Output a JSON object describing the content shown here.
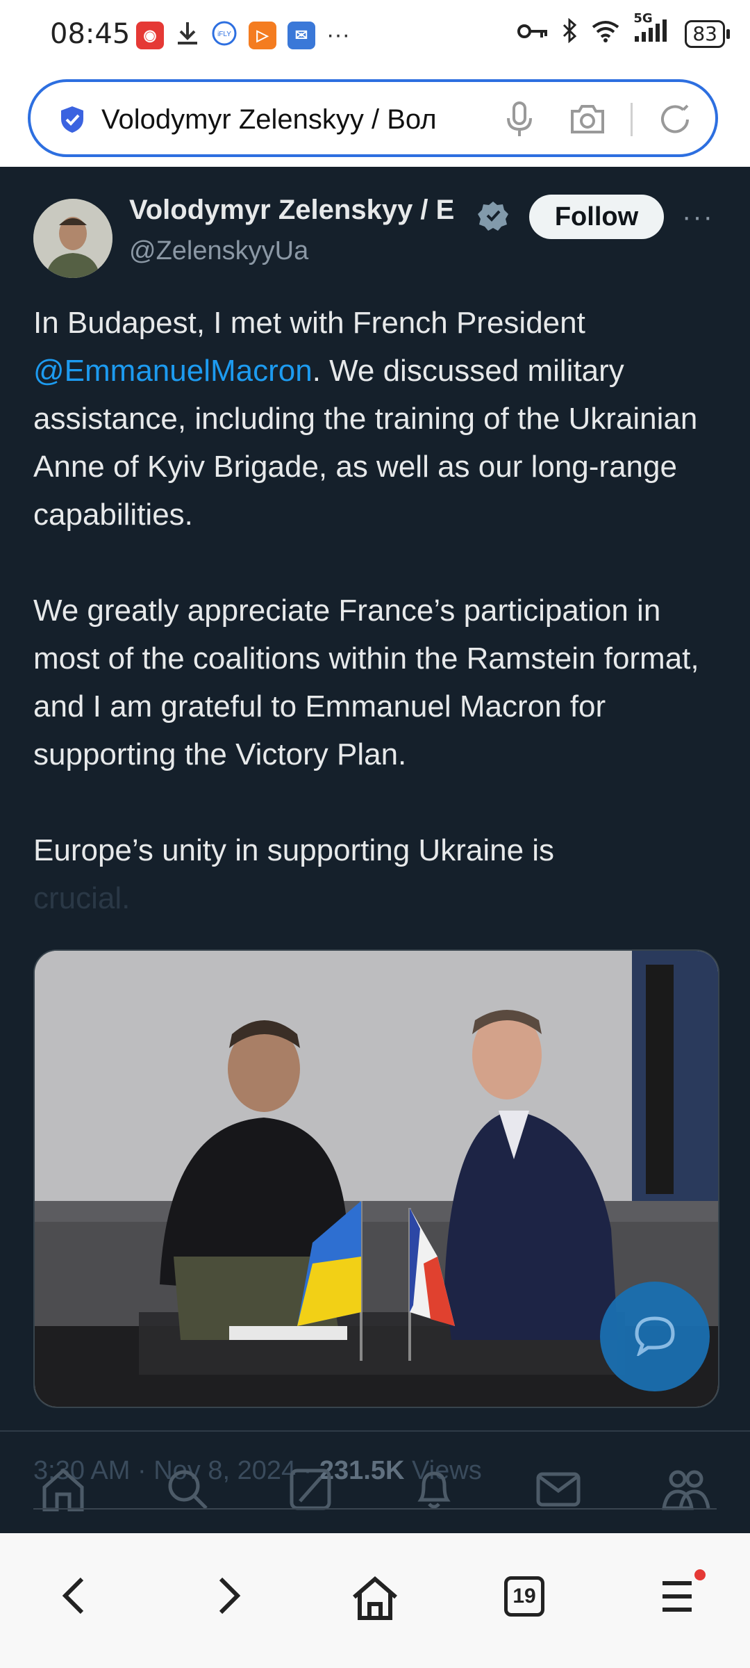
{
  "status_bar": {
    "time": "08:45",
    "network": "5G",
    "battery": "83",
    "overflow": "···"
  },
  "browser": {
    "url_text": "Volodymyr Zelenskyy / Вол",
    "tab_count": "19"
  },
  "tweet": {
    "author_name": "Volodymyr Zelenskyy / E",
    "handle": "@ZelenskyyUa",
    "follow_label": "Follow",
    "more": "···",
    "para1_before": "In Budapest, I met with French President ",
    "mention": "@EmmanuelMacron",
    "para1_after": ". We discussed military assistance, including the training of the Ukrainian Anne of Kyiv Brigade, as well as our long-range capabilities.",
    "para2": "We greatly appreciate France’s participation in most of the coalitions within the Ramstein format, and I am grateful to Emmanuel Macron for supporting the Victory Plan.",
    "para3": "Europe’s unity in supporting Ukraine is",
    "para3_faded": "crucial.",
    "time": "3:30 AM",
    "date": "Nov 8, 2024",
    "views_count": "231.5K",
    "views_label": "Views",
    "sep": "·"
  },
  "x_nav": [
    "home-icon",
    "search-icon",
    "grok-icon",
    "notifications-icon",
    "messages-icon",
    "communities-icon"
  ],
  "browser_nav": [
    "back-icon",
    "forward-icon",
    "home-icon",
    "tabs-icon",
    "menu-icon"
  ],
  "colors": {
    "background": "#15202b",
    "text": "#e7e9ea",
    "secondary": "#8b98a5",
    "link": "#1d9bf0",
    "url_border": "#2d6fe0",
    "fab": "#1a6fb0"
  }
}
